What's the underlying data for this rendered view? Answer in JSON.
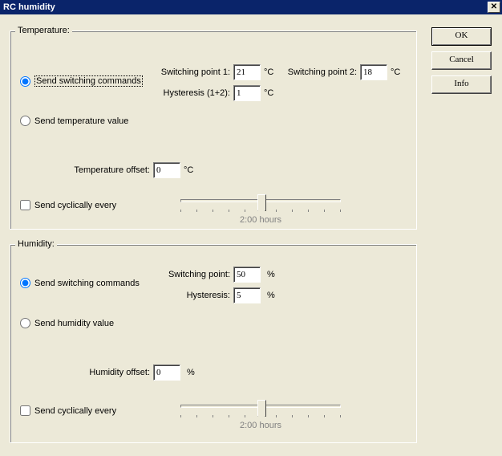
{
  "window": {
    "title": "RC humidity"
  },
  "buttons": {
    "ok": "OK",
    "cancel": "Cancel",
    "info": "Info"
  },
  "temperature": {
    "legend": "Temperature:",
    "send_switching": "Send switching commands",
    "send_value": "Send temperature value",
    "sp1_label": "Switching point 1:",
    "sp1_value": "21",
    "sp2_label": "Switching point 2:",
    "sp2_value": "18",
    "hyst_label": "Hysteresis (1+2):",
    "hyst_value": "1",
    "offset_label": "Temperature offset:",
    "offset_value": "0",
    "unit": "°C",
    "send_cyclically": "Send cyclically every",
    "slider_label": "2:00 hours"
  },
  "humidity": {
    "legend": "Humidity:",
    "send_switching": "Send switching commands",
    "send_value": "Send humidity value",
    "sp_label": "Switching point:",
    "sp_value": "50",
    "hyst_label": "Hysteresis:",
    "hyst_value": "5",
    "offset_label": "Humidity offset:",
    "offset_value": "0",
    "unit": "%",
    "send_cyclically": "Send cyclically every",
    "slider_label": "2:00 hours"
  }
}
